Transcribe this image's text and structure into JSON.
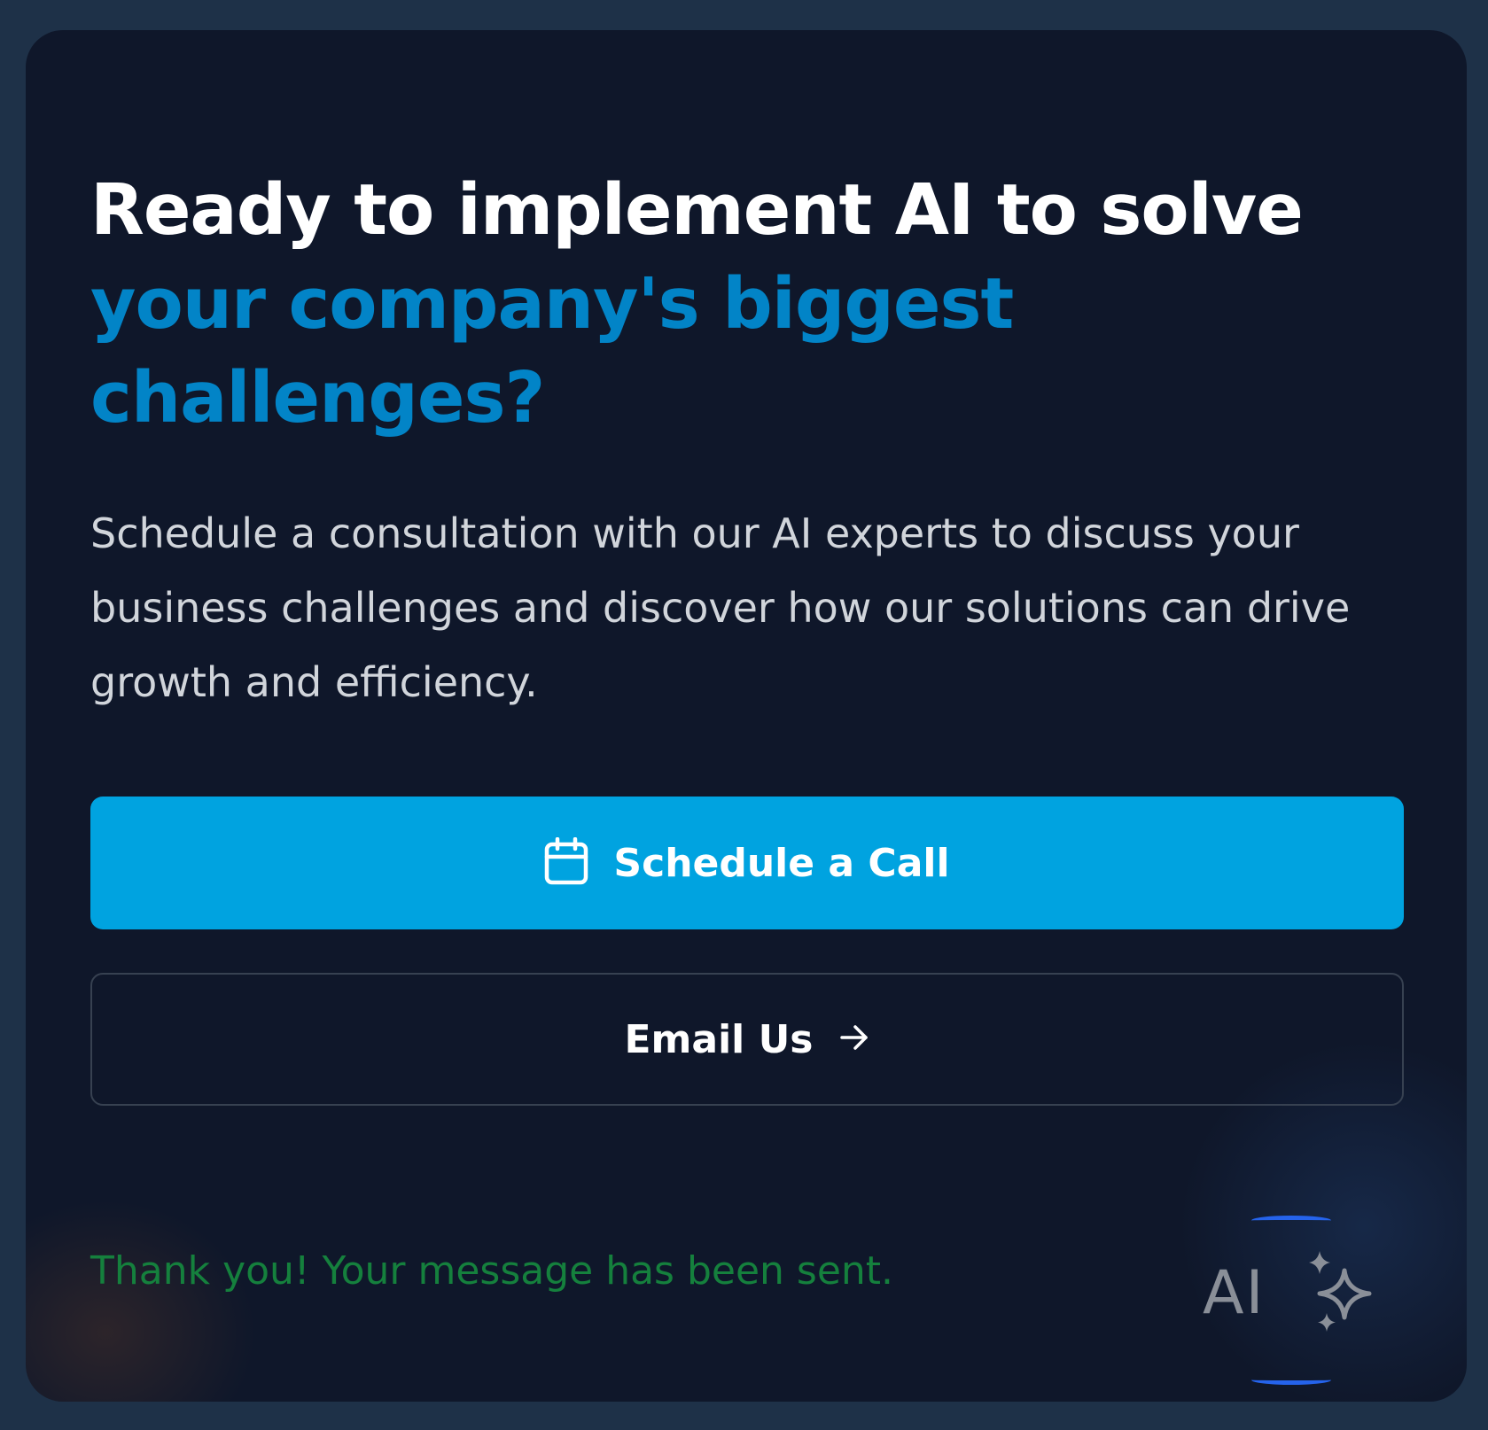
{
  "headline": {
    "line_white": "Ready to implement AI to solve ",
    "line_blue": "your company's biggest challenges?"
  },
  "description": "Schedule a consultation with our AI experts to discuss your business challenges and discover how our solutions can drive growth and efficiency.",
  "buttons": {
    "schedule_label": "Schedule a Call",
    "email_label": "Email Us"
  },
  "success_message": "Thank you! Your message has been sent.",
  "ai_widget": {
    "label": "AI"
  },
  "icons": {
    "schedule": "calendar-icon",
    "email": "arrow-right-icon",
    "ai": "sparkles-icon"
  },
  "colors": {
    "page_background": "#1e3148",
    "card_background": "#0f172a",
    "accent_blue_text": "#0284c7",
    "primary_button": "#00a3e0",
    "success_text": "#15803d",
    "widget_ring": "#2563eb"
  }
}
